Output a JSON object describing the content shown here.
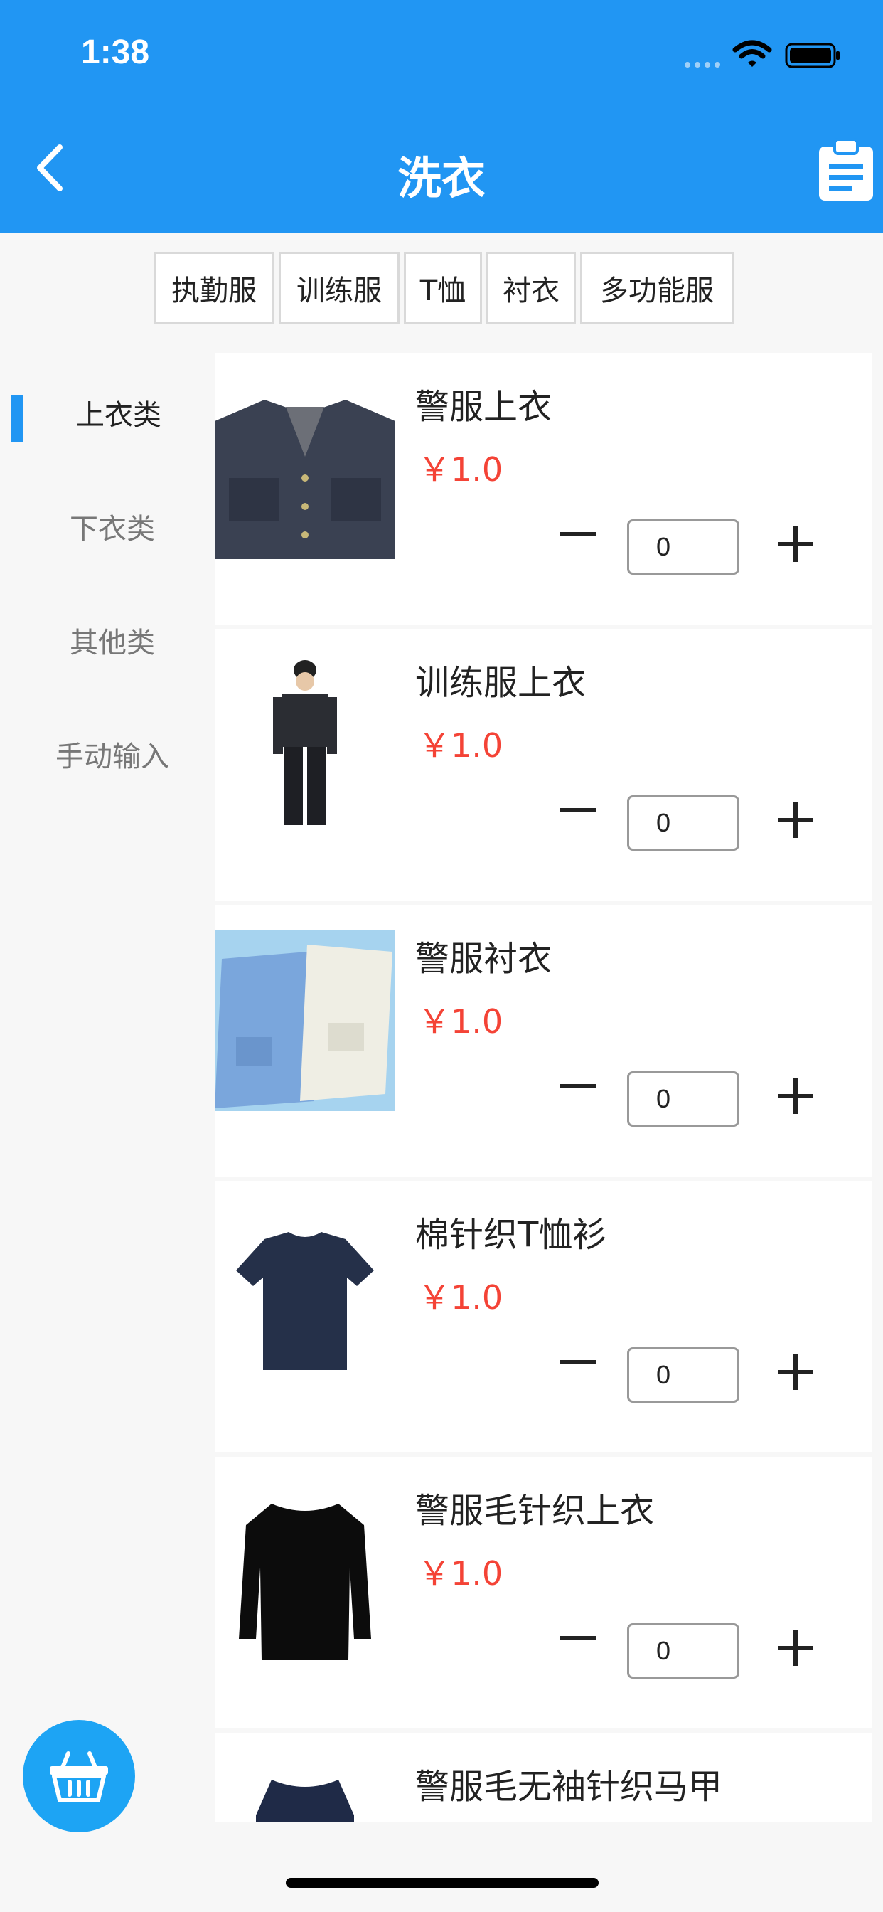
{
  "status_bar": {
    "time": "1:38"
  },
  "header": {
    "title": "洗衣"
  },
  "tabs": [
    {
      "label": "执勤服"
    },
    {
      "label": "训练服"
    },
    {
      "label": "T恤"
    },
    {
      "label": "衬衣"
    },
    {
      "label": "多功能服"
    }
  ],
  "sidebar": {
    "items": [
      {
        "label": "上衣类",
        "active": true
      },
      {
        "label": "下衣类",
        "active": false
      },
      {
        "label": "其他类",
        "active": false
      },
      {
        "label": "手动输入",
        "active": false
      }
    ]
  },
  "products": [
    {
      "name": "警服上衣",
      "price": "￥1.0",
      "qty": "0",
      "image": "police-jacket-image"
    },
    {
      "name": "训练服上衣",
      "price": "￥1.0",
      "qty": "0",
      "image": "training-uniform-image"
    },
    {
      "name": "警服衬衣",
      "price": "￥1.0",
      "qty": "0",
      "image": "police-shirts-image"
    },
    {
      "name": "棉针织T恤衫",
      "price": "￥1.0",
      "qty": "0",
      "image": "tshirt-image"
    },
    {
      "name": "警服毛针织上衣",
      "price": "￥1.0",
      "qty": "0",
      "image": "sweater-image"
    },
    {
      "name": "警服毛无袖针织马甲",
      "price": "",
      "qty": "",
      "image": "vest-image"
    }
  ],
  "colors": {
    "primary": "#2196f3",
    "price": "#f44336",
    "basket": "#1da4f4"
  },
  "icons": {
    "back": "chevron-left-icon",
    "clipboard": "clipboard-icon",
    "basket": "basket-icon"
  }
}
